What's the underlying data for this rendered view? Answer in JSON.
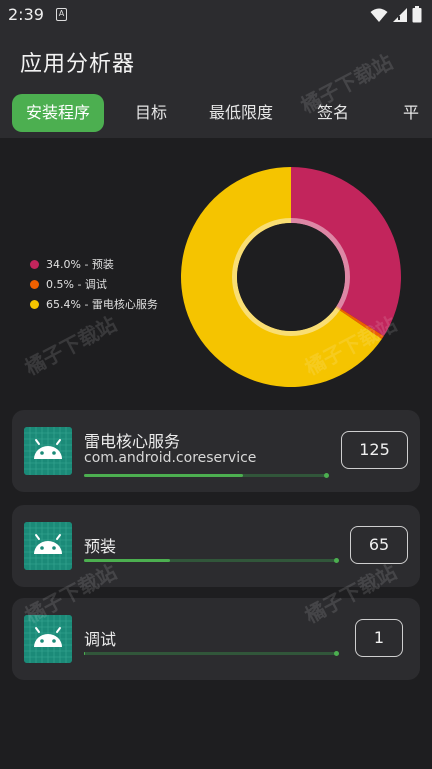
{
  "status": {
    "time": "2:39",
    "a_badge": "A"
  },
  "header": {
    "title": "应用分析器"
  },
  "tabs": [
    {
      "label": "安装程序",
      "active": true
    },
    {
      "label": "目标",
      "active": false
    },
    {
      "label": "最低限度",
      "active": false
    },
    {
      "label": "签名",
      "active": false
    },
    {
      "label": "平",
      "active": false
    }
  ],
  "chart_data": {
    "type": "pie",
    "donut": true,
    "slices": [
      {
        "label": "34.0% - 预装",
        "name": "预装",
        "value": 34.0,
        "color": "#c2255c"
      },
      {
        "label": "0.5% - 调试",
        "name": "调试",
        "value": 0.5,
        "color": "#f06000"
      },
      {
        "label": "65.4% - 雷电核心服务",
        "name": "雷电核心服务",
        "value": 65.4,
        "color": "#f5c400"
      }
    ],
    "legend_position": "left"
  },
  "list": [
    {
      "name": "雷电核心服务",
      "package": "com.android.coreservice",
      "count": "125",
      "progress": 0.65
    },
    {
      "name": "预装",
      "package": "",
      "count": "65",
      "progress": 0.34
    },
    {
      "name": "调试",
      "package": "",
      "count": "1",
      "progress": 0.005
    }
  ],
  "watermark": "橘子下载站",
  "colors": {
    "accent": "#4caf50",
    "background": "#1e1e20",
    "surface": "#2c2c2f"
  }
}
